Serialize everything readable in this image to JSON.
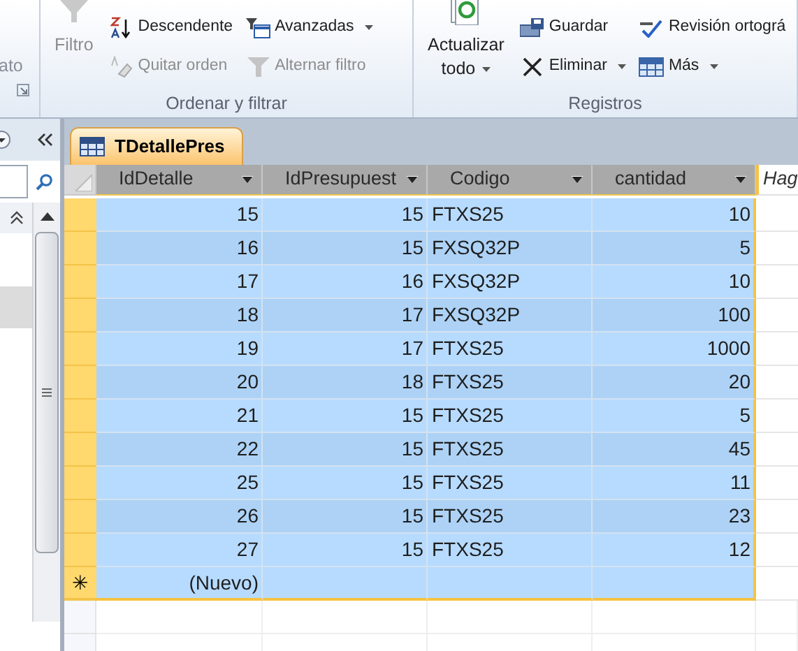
{
  "ribbon": {
    "groups": [
      {
        "label": "ato",
        "launcher": true
      },
      {
        "label": "Ordenar y filtrar",
        "items": [
          {
            "label": "Filtro",
            "kind": "large",
            "disabled": true,
            "dropdown": false
          },
          {
            "label": "Descendente",
            "kind": "small",
            "disabled": false,
            "dropdown": false
          },
          {
            "label": "Quitar orden",
            "kind": "small",
            "disabled": true,
            "dropdown": false
          },
          {
            "label": "Avanzadas",
            "kind": "small",
            "disabled": false,
            "dropdown": true
          },
          {
            "label": "Alternar filtro",
            "kind": "small",
            "disabled": true,
            "dropdown": false
          }
        ]
      },
      {
        "label": "Registros",
        "items": [
          {
            "label": "Actualizar todo",
            "kind": "large",
            "disabled": false,
            "dropdown": true
          },
          {
            "label": "Guardar",
            "kind": "small",
            "disabled": false,
            "dropdown": false
          },
          {
            "label": "Eliminar",
            "kind": "small",
            "disabled": false,
            "dropdown": true
          },
          {
            "label": "Revisión ortográ",
            "kind": "small",
            "disabled": false,
            "dropdown": false
          },
          {
            "label": "Más",
            "kind": "small",
            "disabled": false,
            "dropdown": true
          }
        ]
      }
    ]
  },
  "document_tab": {
    "title": "TDetallePres",
    "selected": true
  },
  "table": {
    "columns": [
      "IdDetalle",
      "IdPresupuest",
      "Codigo",
      "cantidad",
      "Hag"
    ],
    "rows": [
      {
        "cells": [
          "15",
          "15",
          "FTXS25",
          "10"
        ],
        "selected": true
      },
      {
        "cells": [
          "16",
          "15",
          "FXSQ32P",
          "5"
        ],
        "selected": true
      },
      {
        "cells": [
          "17",
          "16",
          "FXSQ32P",
          "10"
        ],
        "selected": true
      },
      {
        "cells": [
          "18",
          "17",
          "FXSQ32P",
          "100"
        ],
        "selected": true
      },
      {
        "cells": [
          "19",
          "17",
          "FTXS25",
          "1000"
        ],
        "selected": true
      },
      {
        "cells": [
          "20",
          "18",
          "FTXS25",
          "20"
        ],
        "selected": true
      },
      {
        "cells": [
          "21",
          "15",
          "FTXS25",
          "5"
        ],
        "selected": true
      },
      {
        "cells": [
          "22",
          "15",
          "FTXS25",
          "45"
        ],
        "selected": true
      },
      {
        "cells": [
          "25",
          "15",
          "FTXS25",
          "11"
        ],
        "selected": true
      },
      {
        "cells": [
          "26",
          "15",
          "FTXS25",
          "23"
        ],
        "selected": true
      },
      {
        "cells": [
          "27",
          "15",
          "FTXS25",
          "12"
        ],
        "selected": true
      }
    ],
    "new_row": {
      "marker": "✳",
      "label": "(Nuevo)",
      "selected": true
    }
  }
}
